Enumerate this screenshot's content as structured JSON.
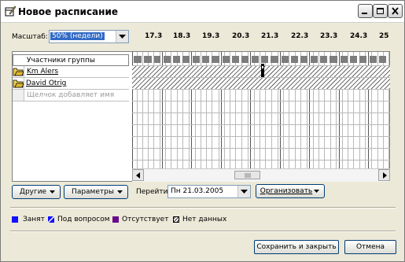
{
  "window": {
    "title": "Новое расписание"
  },
  "toolbar": {
    "scale_label": "Масштаб:",
    "scale_value": "50% (недели)"
  },
  "schedule": {
    "dates": [
      "17.3",
      "18.3",
      "19.3",
      "20.3",
      "21.3",
      "22.3",
      "23.3",
      "24.3",
      "25"
    ],
    "attendees_header": "Участники группы",
    "attendees": [
      "Km Alers",
      "David Otrig"
    ],
    "add_placeholder": "Щелчок добавляет имя"
  },
  "actions": {
    "others_label": "Другие",
    "options_label": "Параметры",
    "goto_label": "Перейти",
    "date_value": "Пн 21.03.2005",
    "organize_label": "Организовать"
  },
  "legend": [
    {
      "label": "Занят",
      "color": "#1010ff",
      "style": "solid"
    },
    {
      "label": "Под вопросом",
      "color": "#1010ff",
      "style": "hatch"
    },
    {
      "label": "Отсутствует",
      "color": "#6a0a8a",
      "style": "solid"
    },
    {
      "label": "Нет данных",
      "color": "#000000",
      "style": "outline-hatch"
    }
  ],
  "footer": {
    "save_close_label": "Сохранить и закрыть",
    "cancel_label": "Отмена"
  }
}
